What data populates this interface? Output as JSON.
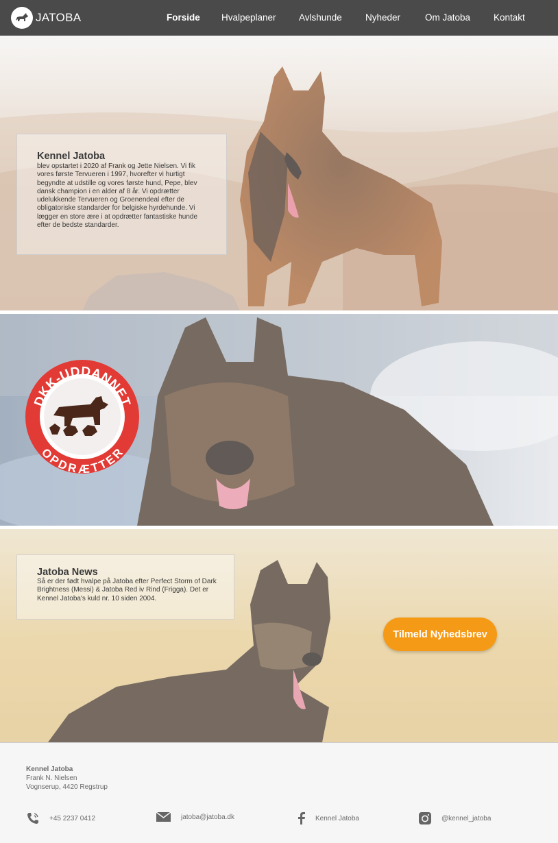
{
  "nav": {
    "brand": "JATOBA",
    "items": [
      "Forside",
      "Hvalpeplaner",
      "Avlshunde",
      "Nyheder",
      "Om Jatoba",
      "Kontakt"
    ],
    "active": "Forside"
  },
  "intro": {
    "title": "Kennel Jatoba",
    "text": "blev opstartet i 2020 af Frank og Jette Nielsen. Vi fik vores første Tervueren i 1997, hvorefter vi hurtigt begyndte at udstille og vores første hund, Pepe, blev dansk champion i en alder af 8 år. Vi opdrætter udelukkende Tervueren og Groenendeal efter de obligatoriske standarder for belgiske hyrdehunde. Vi lægger en store ære i at opdrætter fantastiske hunde efter de bedste standarder."
  },
  "badge": {
    "top_text": "DKK-UDDANNET",
    "bottom_text": "OPDRÆTTER"
  },
  "news": {
    "title": "Jatoba News",
    "text": "Så er der født hvalpe på Jatoba efter Perfect Storm of Dark Brightness (Messi) & Jatoba Red iv Rind (Frigga). Det er Kennel Jatoba's kuld nr. 10 siden 2004.",
    "cta_label": "Tilmeld Nyhedsbrev"
  },
  "footer": {
    "name": "Kennel Jatoba",
    "owner": "Frank N. Nielsen",
    "address": "Vognserup, 4420 Regstrup",
    "phone": "+45 2237 0412",
    "email": "jatoba@jatoba.dk",
    "facebook": "Kennel Jatoba",
    "instagram": "@kennel_jatoba"
  },
  "icons": {
    "logo": "dog-logo-icon",
    "phone": "phone-icon",
    "email": "envelope-icon",
    "facebook": "facebook-icon",
    "instagram": "instagram-icon"
  },
  "colors": {
    "nav_bg": "#4a4a4a",
    "cta": "#f59a17",
    "badge_red": "#e23a34",
    "footer_bg": "#f6f6f6"
  }
}
